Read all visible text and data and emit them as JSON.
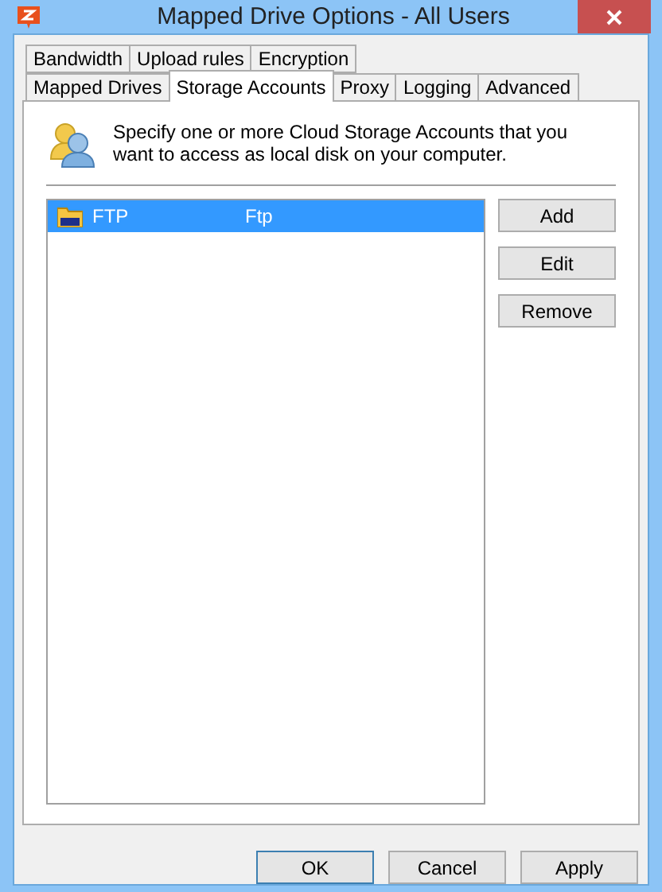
{
  "window": {
    "title": "Mapped Drive Options - All Users"
  },
  "tab_rows": [
    [
      {
        "label": "Bandwidth",
        "selected": false
      },
      {
        "label": "Upload rules",
        "selected": false
      },
      {
        "label": "Encryption",
        "selected": false
      }
    ],
    [
      {
        "label": "Mapped Drives",
        "selected": false
      },
      {
        "label": "Storage Accounts",
        "selected": true
      },
      {
        "label": "Proxy",
        "selected": false
      },
      {
        "label": "Logging",
        "selected": false
      },
      {
        "label": "Advanced",
        "selected": false
      }
    ]
  ],
  "description": "Specify one or more Cloud Storage Accounts that you want to access as local disk on your computer.",
  "accounts": [
    {
      "name": "FTP",
      "type": "Ftp",
      "selected": true
    }
  ],
  "side_buttons": [
    "Add",
    "Edit",
    "Remove"
  ],
  "dialog_buttons": [
    {
      "label": "OK",
      "default": true
    },
    {
      "label": "Cancel",
      "default": false
    },
    {
      "label": "Apply",
      "default": false
    }
  ]
}
